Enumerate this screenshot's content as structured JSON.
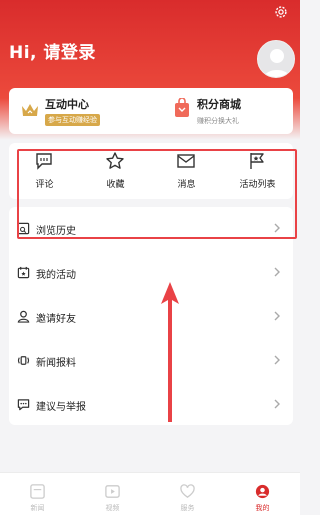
{
  "colors": {
    "brand": "#d92c2c",
    "gold": "#d7a84a",
    "highlight": "#e94246"
  },
  "header": {
    "greeting": "Hi, 请登录"
  },
  "cards": {
    "interaction": {
      "title": "互动中心",
      "badge": "参与互动赚经验",
      "icon": "crown-icon"
    },
    "points_mall": {
      "title": "积分商城",
      "subtitle": "赚积分换大礼",
      "icon": "shopping-bag-icon"
    }
  },
  "quick_actions": [
    {
      "label": "评论",
      "icon": "comment-icon"
    },
    {
      "label": "收藏",
      "icon": "star-icon"
    },
    {
      "label": "消息",
      "icon": "mail-icon"
    },
    {
      "label": "活动列表",
      "icon": "flag-icon"
    }
  ],
  "menu": [
    {
      "label": "浏览历史",
      "icon": "history-icon"
    },
    {
      "label": "我的活动",
      "icon": "calendar-icon"
    },
    {
      "label": "邀请好友",
      "icon": "user-icon"
    },
    {
      "label": "新闻报料",
      "icon": "broadcast-icon"
    },
    {
      "label": "建议与举报",
      "icon": "feedback-icon"
    }
  ],
  "tabs": [
    {
      "label": "新闻",
      "icon": "news-icon"
    },
    {
      "label": "视频",
      "icon": "video-icon"
    },
    {
      "label": "服务",
      "icon": "service-icon"
    },
    {
      "label": "我的",
      "icon": "profile-icon",
      "active": true
    }
  ]
}
